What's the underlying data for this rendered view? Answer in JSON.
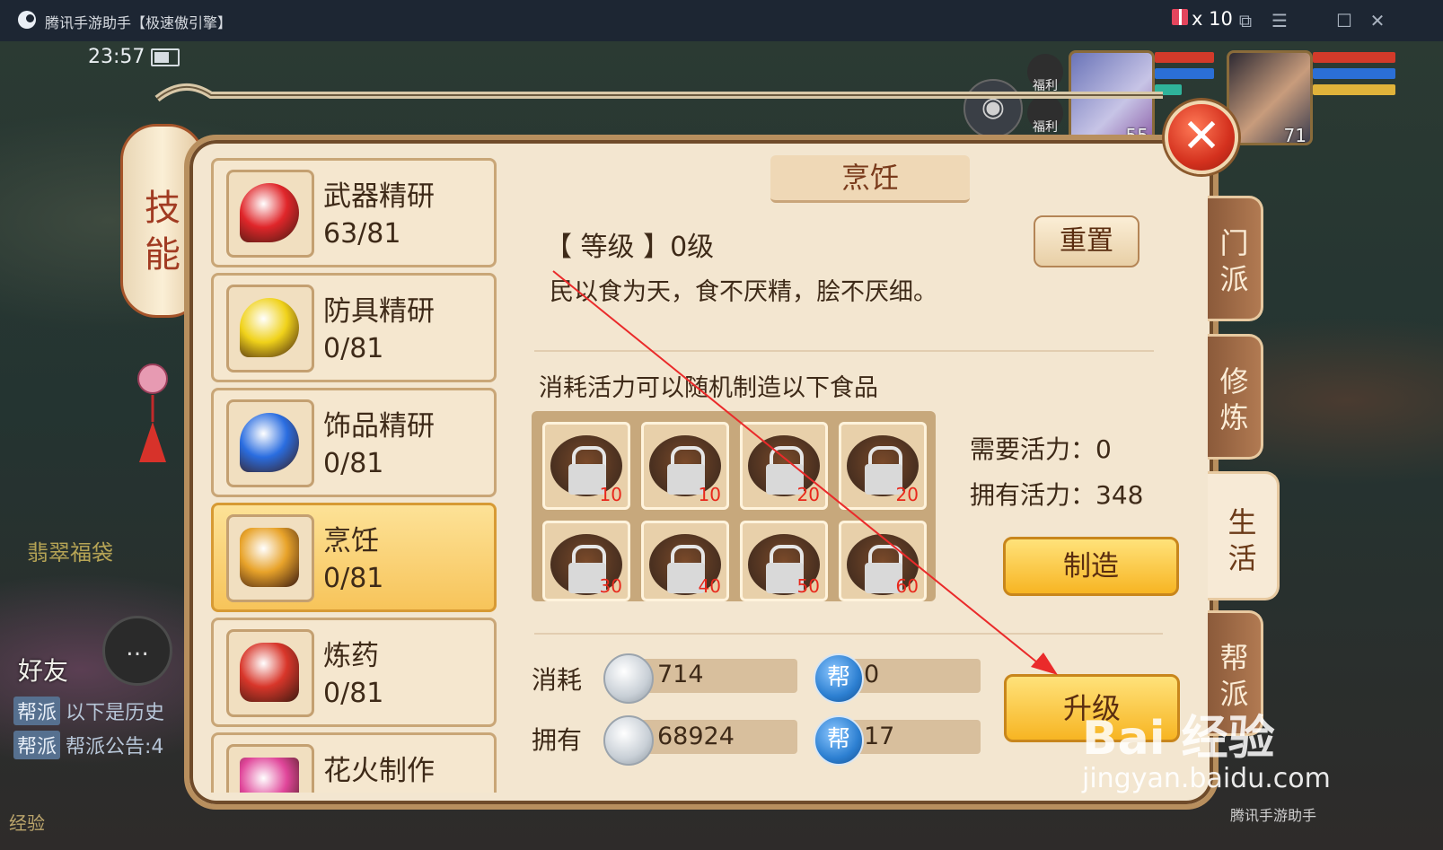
{
  "window": {
    "title": "腾讯手游助手【极速傲引擎】",
    "gift_count": "x 10",
    "controls": [
      "⧉",
      "☰",
      "☐",
      "✕"
    ]
  },
  "status": {
    "time": "23:57"
  },
  "scene": {
    "fudai_label": "翡翠福袋",
    "friend_label": "好友",
    "chat_icon": "…",
    "fuli_1": "福利",
    "fuli_2": "福利",
    "portrait_1_level": "55",
    "portrait_2_level": "71",
    "chat": [
      {
        "tag": "帮派",
        "text": "以下是历史"
      },
      {
        "tag": "帮派",
        "text": "帮派公告:4"
      }
    ],
    "exp_label": "经验"
  },
  "lantern": {
    "chars": [
      "技",
      "能"
    ]
  },
  "skills": [
    {
      "name": "武器精研",
      "progress": "63/81",
      "color": "#e0262a"
    },
    {
      "name": "防具精研",
      "progress": "0/81",
      "color": "#f0d21a"
    },
    {
      "name": "饰品精研",
      "progress": "0/81",
      "color": "#2a6de0"
    },
    {
      "name": "烹饪",
      "progress": "0/81",
      "color": "#e8a32a"
    },
    {
      "name": "炼药",
      "progress": "0/81",
      "color": "#d8362a"
    },
    {
      "name": "花火制作",
      "progress": "",
      "color": "#e0469a"
    }
  ],
  "detail": {
    "header": "烹饪",
    "level_line": "【 等级 】0级",
    "reset_label": "重置",
    "motto": "民以食为天，食不厌精，脍不厌细。",
    "hint": "消耗活力可以随机制造以下食品",
    "foods": [
      {
        "cost": "10"
      },
      {
        "cost": "10"
      },
      {
        "cost": "20"
      },
      {
        "cost": "20"
      },
      {
        "cost": "30"
      },
      {
        "cost": "40"
      },
      {
        "cost": "50"
      },
      {
        "cost": "60"
      }
    ],
    "need_vigor": "需要活力：0",
    "have_vigor": "拥有活力：348",
    "make_label": "制造",
    "consume_label": "消耗",
    "own_label": "拥有",
    "consume_silver": "714",
    "consume_bang": "0",
    "own_silver": "68924",
    "own_bang": "17",
    "bang_icon": "帮",
    "upgrade_label": "升级"
  },
  "side_tabs": [
    {
      "label": [
        "门",
        "派"
      ]
    },
    {
      "label": [
        "修",
        "炼"
      ]
    },
    {
      "label": [
        "生",
        "活"
      ]
    },
    {
      "label": [
        "帮",
        "派"
      ]
    }
  ],
  "watermark": {
    "brand": "Bai 经验",
    "url": "jingyan.baidu.com",
    "footer": "腾讯手游助手"
  }
}
